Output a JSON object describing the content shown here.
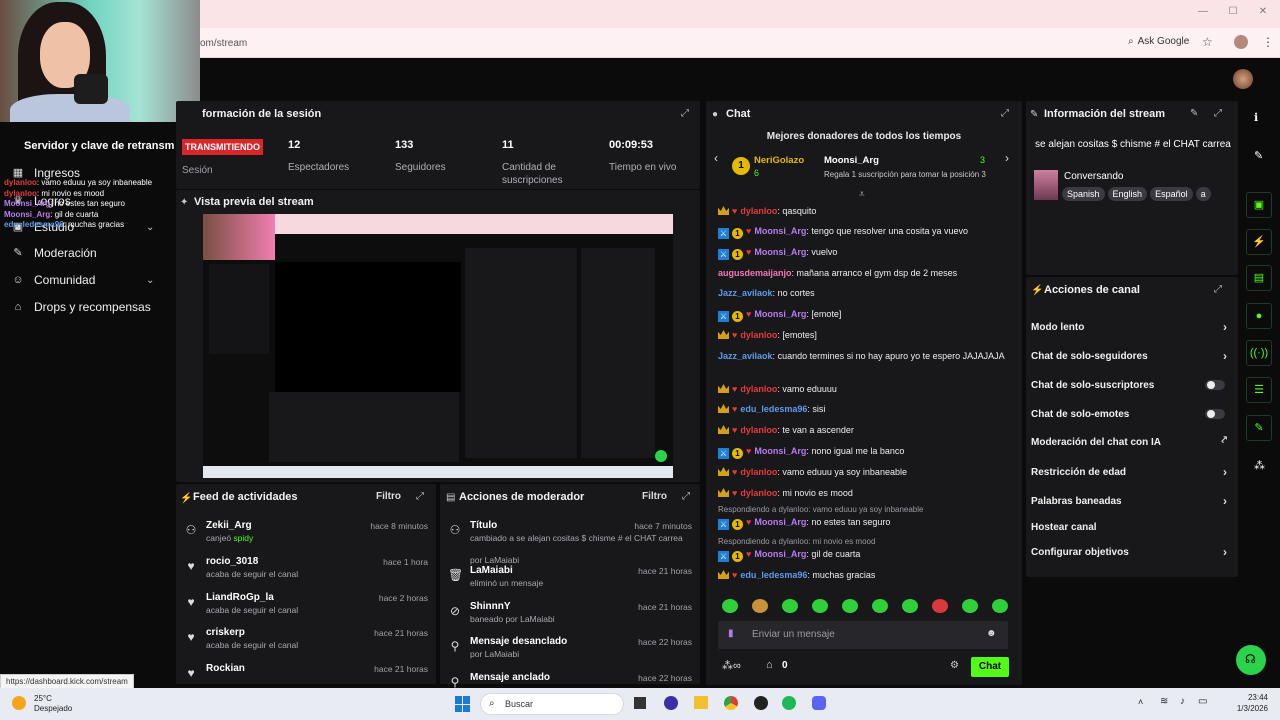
{
  "browser": {
    "url": "om/stream",
    "ask_google": "Ask Google",
    "status_url": "https://dashboard.kick.com/stream"
  },
  "sidebar": {
    "header": "Servidor y clave de retransm",
    "items": [
      {
        "label": "Ingresos",
        "icon": "revenue-icon"
      },
      {
        "label": "Logros",
        "icon": "trophy-icon"
      },
      {
        "label": "Estudio",
        "icon": "studio-icon"
      },
      {
        "label": "Moderación",
        "icon": "wrench-icon"
      },
      {
        "label": "Comunidad",
        "icon": "people-icon"
      },
      {
        "label": "Drops y recompensas",
        "icon": "gift-icon"
      }
    ],
    "overlay_chat": [
      {
        "user": "dylanloo",
        "text": "vamo eduuu ya soy inbaneable"
      },
      {
        "user": "dylanloo",
        "text": "mi novio es mood"
      },
      {
        "user": "Moonsi_Arg",
        "text": "no estes tan seguro"
      },
      {
        "user": "Moonsi_Arg",
        "text": "gil de cuarta"
      },
      {
        "user": "edu_ledesma96",
        "text": "muchas gracias"
      }
    ]
  },
  "session": {
    "title": "formación de la sesión",
    "badge": "TRANSMITIENDO",
    "badge_sub": "Sesión",
    "stats": [
      {
        "value": "12",
        "label": "Espectadores"
      },
      {
        "value": "133",
        "label": "Seguidores"
      },
      {
        "value": "11",
        "label": "Cantidad de suscripciones"
      },
      {
        "value": "00:09:53",
        "label": "Tiempo en vivo"
      }
    ]
  },
  "preview": {
    "title": "Vista previa del stream"
  },
  "feed": {
    "title": "Feed de actividades",
    "filter": "Filtro",
    "rows": [
      {
        "name": "Zekii_Arg",
        "sub": "canjeó ",
        "sub_hl": "spidy",
        "time": "hace 8 minutos"
      },
      {
        "name": "rocio_3018",
        "sub": "acaba de seguir el canal",
        "sub_hl": "",
        "time": "hace 1 hora"
      },
      {
        "name": "LiandRoGp_la",
        "sub": "acaba de seguir el canal",
        "sub_hl": "",
        "time": "hace 2 horas"
      },
      {
        "name": "criskerp",
        "sub": "acaba de seguir el canal",
        "sub_hl": "",
        "time": "hace 21 horas"
      },
      {
        "name": "Rockian",
        "sub": "acaba de seguir el canal",
        "sub_hl": "",
        "time": "hace 21 horas"
      }
    ]
  },
  "mod_actions": {
    "title": "Acciones de moderador",
    "filter": "Filtro",
    "rows": [
      {
        "name": "Título",
        "sub": "cambiado a se alejan cositas $ chisme # el CHAT carrea",
        "by": "por LaMaiabi",
        "time": "hace 7 minutos"
      },
      {
        "name": "LaMaiabi",
        "sub": "eliminó un mensaje",
        "by": "",
        "time": "hace 21 horas"
      },
      {
        "name": "ShinnnY",
        "sub": "baneado por LaMaiabi",
        "by": "",
        "time": "hace 21 horas"
      },
      {
        "name": "Mensaje desanclado",
        "sub": "por LaMaiabi",
        "by": "",
        "time": "hace 22 horas"
      },
      {
        "name": "Mensaje anclado",
        "sub": "",
        "by": "",
        "time": "hace 22 horas"
      }
    ]
  },
  "chat": {
    "title": "Chat",
    "donors_title": "Mejores donadores de todos los tiempos",
    "donor_rank": "1",
    "donor1": "NeriGolazo",
    "donor1_count": "6",
    "donor2": "Moonsi_Arg",
    "donor2_count": "3",
    "donor_promo": "Regala 1 suscripción para tomar la posición 3",
    "messages": [
      {
        "badges": [
          "crown",
          "heart"
        ],
        "user": "dylanloo",
        "cls": "u-red",
        "text": "qasquito"
      },
      {
        "badges": [
          "mod",
          "sub",
          "heart"
        ],
        "user": "Moonsi_Arg",
        "cls": "u-purple",
        "text": "tengo que resolver una cosita ya vuevo"
      },
      {
        "badges": [
          "mod",
          "sub",
          "heart"
        ],
        "user": "Moonsi_Arg",
        "cls": "u-purple",
        "text": "vuelvo"
      },
      {
        "badges": [],
        "user": "augusdemaijanjo",
        "cls": "u-pink",
        "text": "mañana arranco el gym dsp de 2 meses"
      },
      {
        "badges": [],
        "user": "Jazz_avilaok",
        "cls": "u-blue",
        "text": "no cortes"
      },
      {
        "badges": [
          "mod",
          "sub",
          "heart"
        ],
        "user": "Moonsi_Arg",
        "cls": "u-purple",
        "text": "[emote]"
      },
      {
        "badges": [
          "crown",
          "heart"
        ],
        "user": "dylanloo",
        "cls": "u-red",
        "text": "[emotes]"
      },
      {
        "badges": [],
        "user": "Jazz_avilaok",
        "cls": "u-blue",
        "text": "cuando termines si no hay apuro yo te espero JAJAJAJA"
      },
      {
        "badges": [
          "crown",
          "heart"
        ],
        "user": "dylanloo",
        "cls": "u-red",
        "text": "vamo eduuuu"
      },
      {
        "badges": [
          "crown",
          "heart"
        ],
        "user": "edu_ledesma96",
        "cls": "u-blue",
        "text": "sisi"
      },
      {
        "badges": [
          "crown",
          "heart"
        ],
        "user": "dylanloo",
        "cls": "u-red",
        "text": "te van a ascender"
      },
      {
        "badges": [
          "mod",
          "sub",
          "heart"
        ],
        "user": "Moonsi_Arg",
        "cls": "u-purple",
        "text": "nono igual me la banco"
      },
      {
        "badges": [
          "crown",
          "heart"
        ],
        "user": "dylanloo",
        "cls": "u-red",
        "text": "vamo eduuu ya soy inbaneable"
      },
      {
        "badges": [
          "crown",
          "heart"
        ],
        "user": "dylanloo",
        "cls": "u-red",
        "text": "mi novio es mood"
      },
      {
        "badges": [
          "mod",
          "sub",
          "heart"
        ],
        "user": "Moonsi_Arg",
        "cls": "u-purple",
        "text": "no estes tan seguro",
        "reply": "Respondiendo a dylanloo: vamo eduuu ya soy inbaneable"
      },
      {
        "badges": [
          "mod",
          "sub",
          "heart"
        ],
        "user": "Moonsi_Arg",
        "cls": "u-purple",
        "text": "gil de cuarta",
        "reply": "Respondiendo a dylanloo: mi novio es mood"
      },
      {
        "badges": [
          "crown",
          "heart"
        ],
        "user": "edu_ledesma96",
        "cls": "u-blue",
        "text": "muchas gracias"
      }
    ],
    "input_placeholder": "Enviar un mensaje",
    "kicks": "0",
    "send": "Chat"
  },
  "stream_info": {
    "title": "Información del stream",
    "stream_title": "se alejan cositas $ chisme # el CHAT carrea",
    "category": "Conversando",
    "tags": [
      "Spanish",
      "English",
      "Español",
      "a"
    ]
  },
  "channel_actions": {
    "title": "Acciones de canal",
    "items": [
      {
        "label": "Modo lento",
        "ctl": "chevron"
      },
      {
        "label": "Chat de solo-seguidores",
        "ctl": "chevron"
      },
      {
        "label": "Chat de solo-suscriptores",
        "ctl": "toggle"
      },
      {
        "label": "Chat de solo-emotes",
        "ctl": "toggle"
      },
      {
        "label": "Moderación del chat con IA",
        "ctl": "external"
      },
      {
        "label": "Restricción de edad",
        "ctl": "chevron"
      },
      {
        "label": "Palabras baneadas",
        "ctl": "chevron"
      },
      {
        "label": "Hostear canal",
        "ctl": "none"
      },
      {
        "label": "Configurar objetivos",
        "ctl": "chevron"
      }
    ]
  },
  "taskbar": {
    "temp": "25°C",
    "weather": "Despejado",
    "search": "Buscar",
    "time": "23:44",
    "date": "1/3/2026"
  },
  "colors": {
    "accent": "#53fc18",
    "live": "#d9262b",
    "panel": "#18181b"
  }
}
